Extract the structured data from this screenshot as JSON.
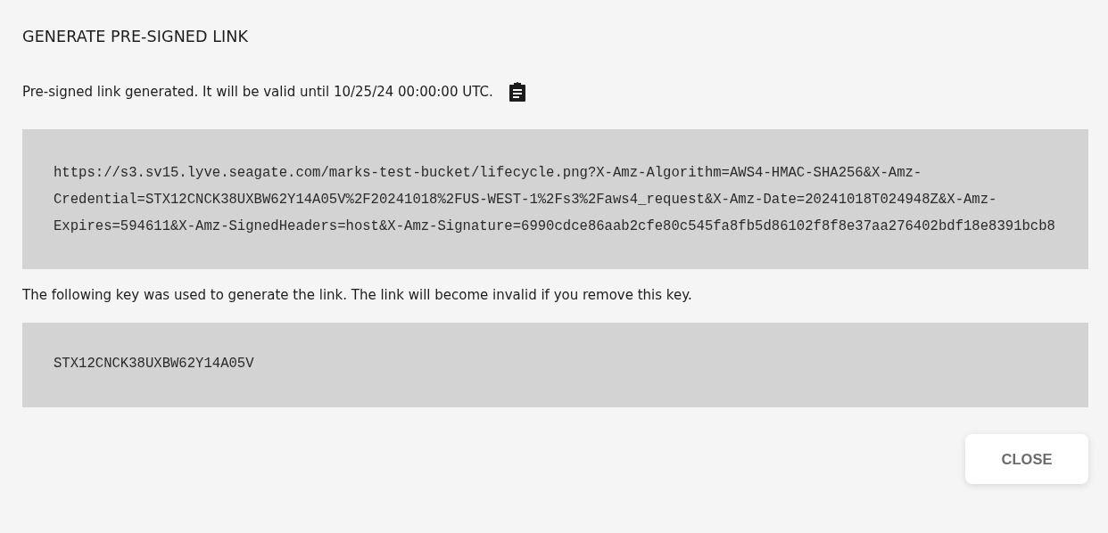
{
  "dialog": {
    "title": "GENERATE PRE-SIGNED LINK",
    "status_message": "Pre-signed link generated. It will be valid until 10/25/24 00:00:00 UTC.",
    "link": "https://s3.sv15.lyve.seagate.com/marks-test-bucket/lifecycle.png?X-Amz-Algorithm=AWS4-HMAC-SHA256&X-Amz-Credential=STX12CNCK38UXBW62Y14A05V%2F20241018%2FUS-WEST-1%2Fs3%2Faws4_request&X-Amz-Date=20241018T024948Z&X-Amz-Expires=594611&X-Amz-SignedHeaders=host&X-Amz-Signature=6990cdce86aab2cfe80c545fa8fb5d86102f8f8e37aa276402bdf18e8391bcb8",
    "key_message": "The following key was used to generate the link. The link will become invalid if you remove this key.",
    "key": "STX12CNCK38UXBW62Y14A05V",
    "buttons": [
      {
        "label": "CLOSE"
      }
    ]
  }
}
